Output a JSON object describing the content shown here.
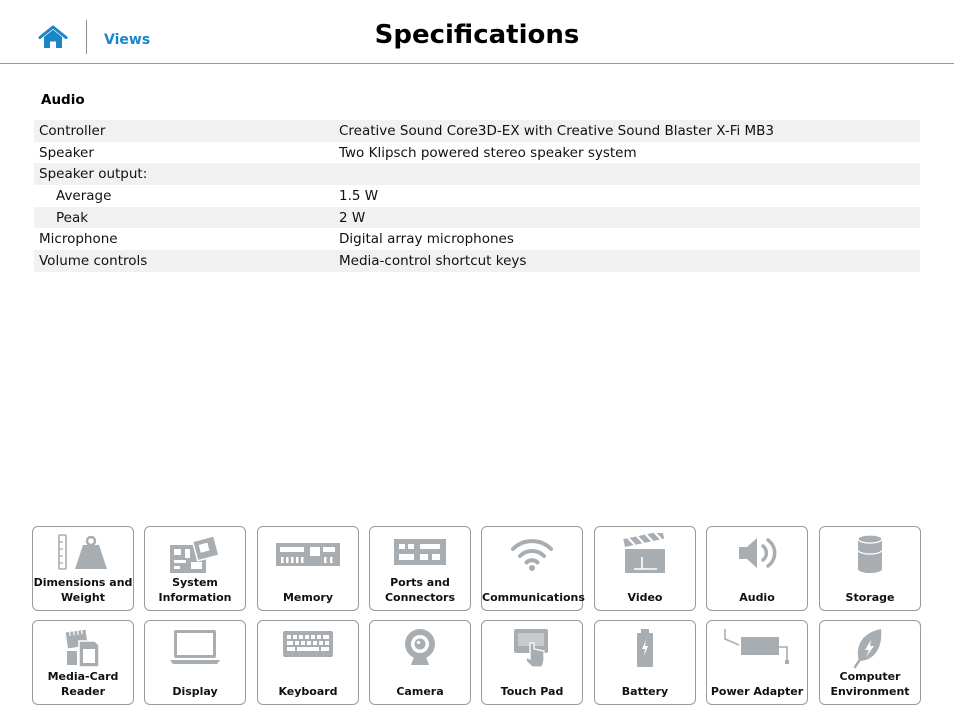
{
  "header": {
    "home_icon": "home-icon",
    "views_label": "Views",
    "title": "Specifications"
  },
  "colors": {
    "accent": "#1a86c8",
    "icon_gray": "#a8adb2",
    "row_shade": "#f1f1f1"
  },
  "section": {
    "title": "Audio",
    "rows": [
      {
        "key": "Controller",
        "value": "Creative Sound Core3D-EX with Creative Sound Blaster X-Fi MB3"
      },
      {
        "key": "Speaker",
        "value": "Two Klipsch powered stereo speaker system"
      },
      {
        "key": "Speaker output:",
        "value": ""
      },
      {
        "key": "Average",
        "value": "1.5 W"
      },
      {
        "key": "Peak",
        "value": "2 W"
      },
      {
        "key": "Microphone",
        "value": "Digital array microphones"
      },
      {
        "key": "Volume controls",
        "value": "Media-control shortcut keys"
      }
    ]
  },
  "nav_tiles": [
    {
      "label": "Dimensions and Weight",
      "icon": "weight-icon"
    },
    {
      "label": "System Information",
      "icon": "motherboard-icon"
    },
    {
      "label": "Memory",
      "icon": "memory-icon"
    },
    {
      "label": "Ports and Connectors",
      "icon": "ports-icon"
    },
    {
      "label": "Communications",
      "icon": "wifi-icon"
    },
    {
      "label": "Video",
      "icon": "clapperboard-icon"
    },
    {
      "label": "Audio",
      "icon": "speaker-icon"
    },
    {
      "label": "Storage",
      "icon": "storage-icon"
    },
    {
      "label": "Media-Card Reader",
      "icon": "media-card-icon"
    },
    {
      "label": "Display",
      "icon": "display-icon"
    },
    {
      "label": "Keyboard",
      "icon": "keyboard-icon"
    },
    {
      "label": "Camera",
      "icon": "camera-icon"
    },
    {
      "label": "Touch Pad",
      "icon": "touchpad-icon"
    },
    {
      "label": "Battery",
      "icon": "battery-icon"
    },
    {
      "label": "Power Adapter",
      "icon": "power-adapter-icon"
    },
    {
      "label": "Computer Environment",
      "icon": "leaf-icon"
    }
  ]
}
